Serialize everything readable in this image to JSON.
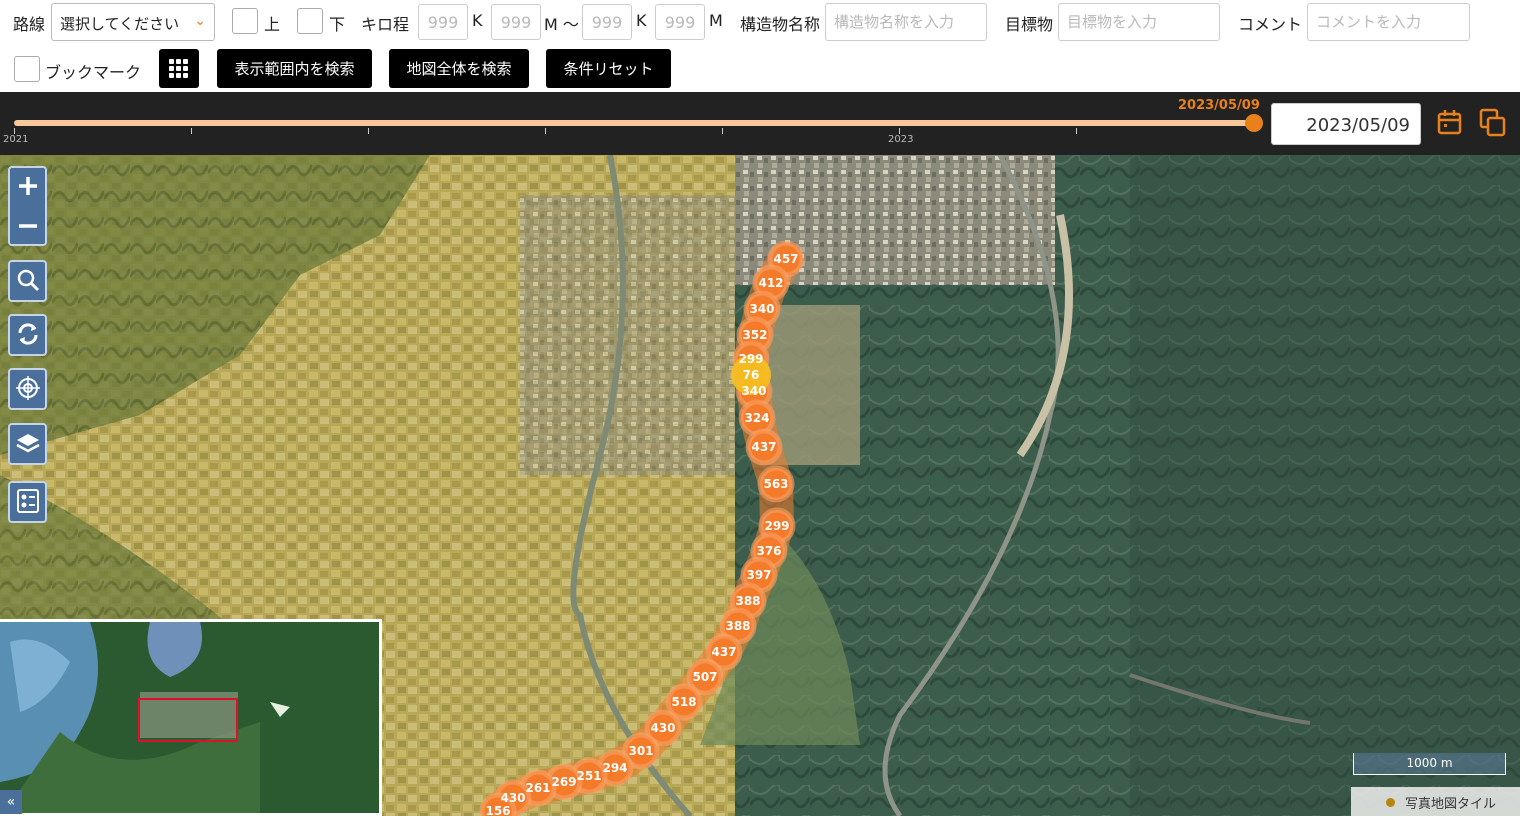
{
  "filters": {
    "route_label": "路線",
    "route_select_value": "選択してください",
    "up_label": "上",
    "down_label": "下",
    "kilo_label": "キロ程",
    "kilo_placeholder": "999",
    "k_unit": "K",
    "m_unit": "M",
    "m_range_unit": "M ～",
    "structure_label": "構造物名称",
    "structure_placeholder": "構造物名称を入力",
    "landmark_label": "目標物",
    "landmark_placeholder": "目標物を入力",
    "comment_label": "コメント",
    "comment_placeholder": "コメントを入力",
    "bookmark_label": "ブックマーク",
    "search_view_button": "表示範囲内を検索",
    "search_all_button": "地図全体を検索",
    "reset_button": "条件リセット"
  },
  "timeline": {
    "selected_date_label": "2023/05/09",
    "date_input_value": "2023/05/09",
    "year_labels": [
      "2021",
      "2023"
    ],
    "accent_color": "#e8801c"
  },
  "map": {
    "clusters": [
      "457",
      "412",
      "340",
      "352",
      "299",
      "76",
      "340",
      "324",
      "437",
      "563",
      "299",
      "376",
      "397",
      "388",
      "388",
      "437",
      "507",
      "518",
      "430",
      "301",
      "294",
      "251",
      "269",
      "261",
      "430",
      "156"
    ],
    "scale_label": "1000 m",
    "attribution": "写真地図タイル",
    "cluster_color": "#f47b2a",
    "highlight_color": "#f5c020"
  },
  "icons": [
    "plus-icon",
    "minus-icon",
    "search-icon",
    "refresh-icon",
    "target-icon",
    "layers-icon",
    "legend-icon",
    "calendar-icon",
    "copy-icon",
    "grid-icon",
    "chevron-down-icon",
    "double-chevron-left-icon"
  ]
}
